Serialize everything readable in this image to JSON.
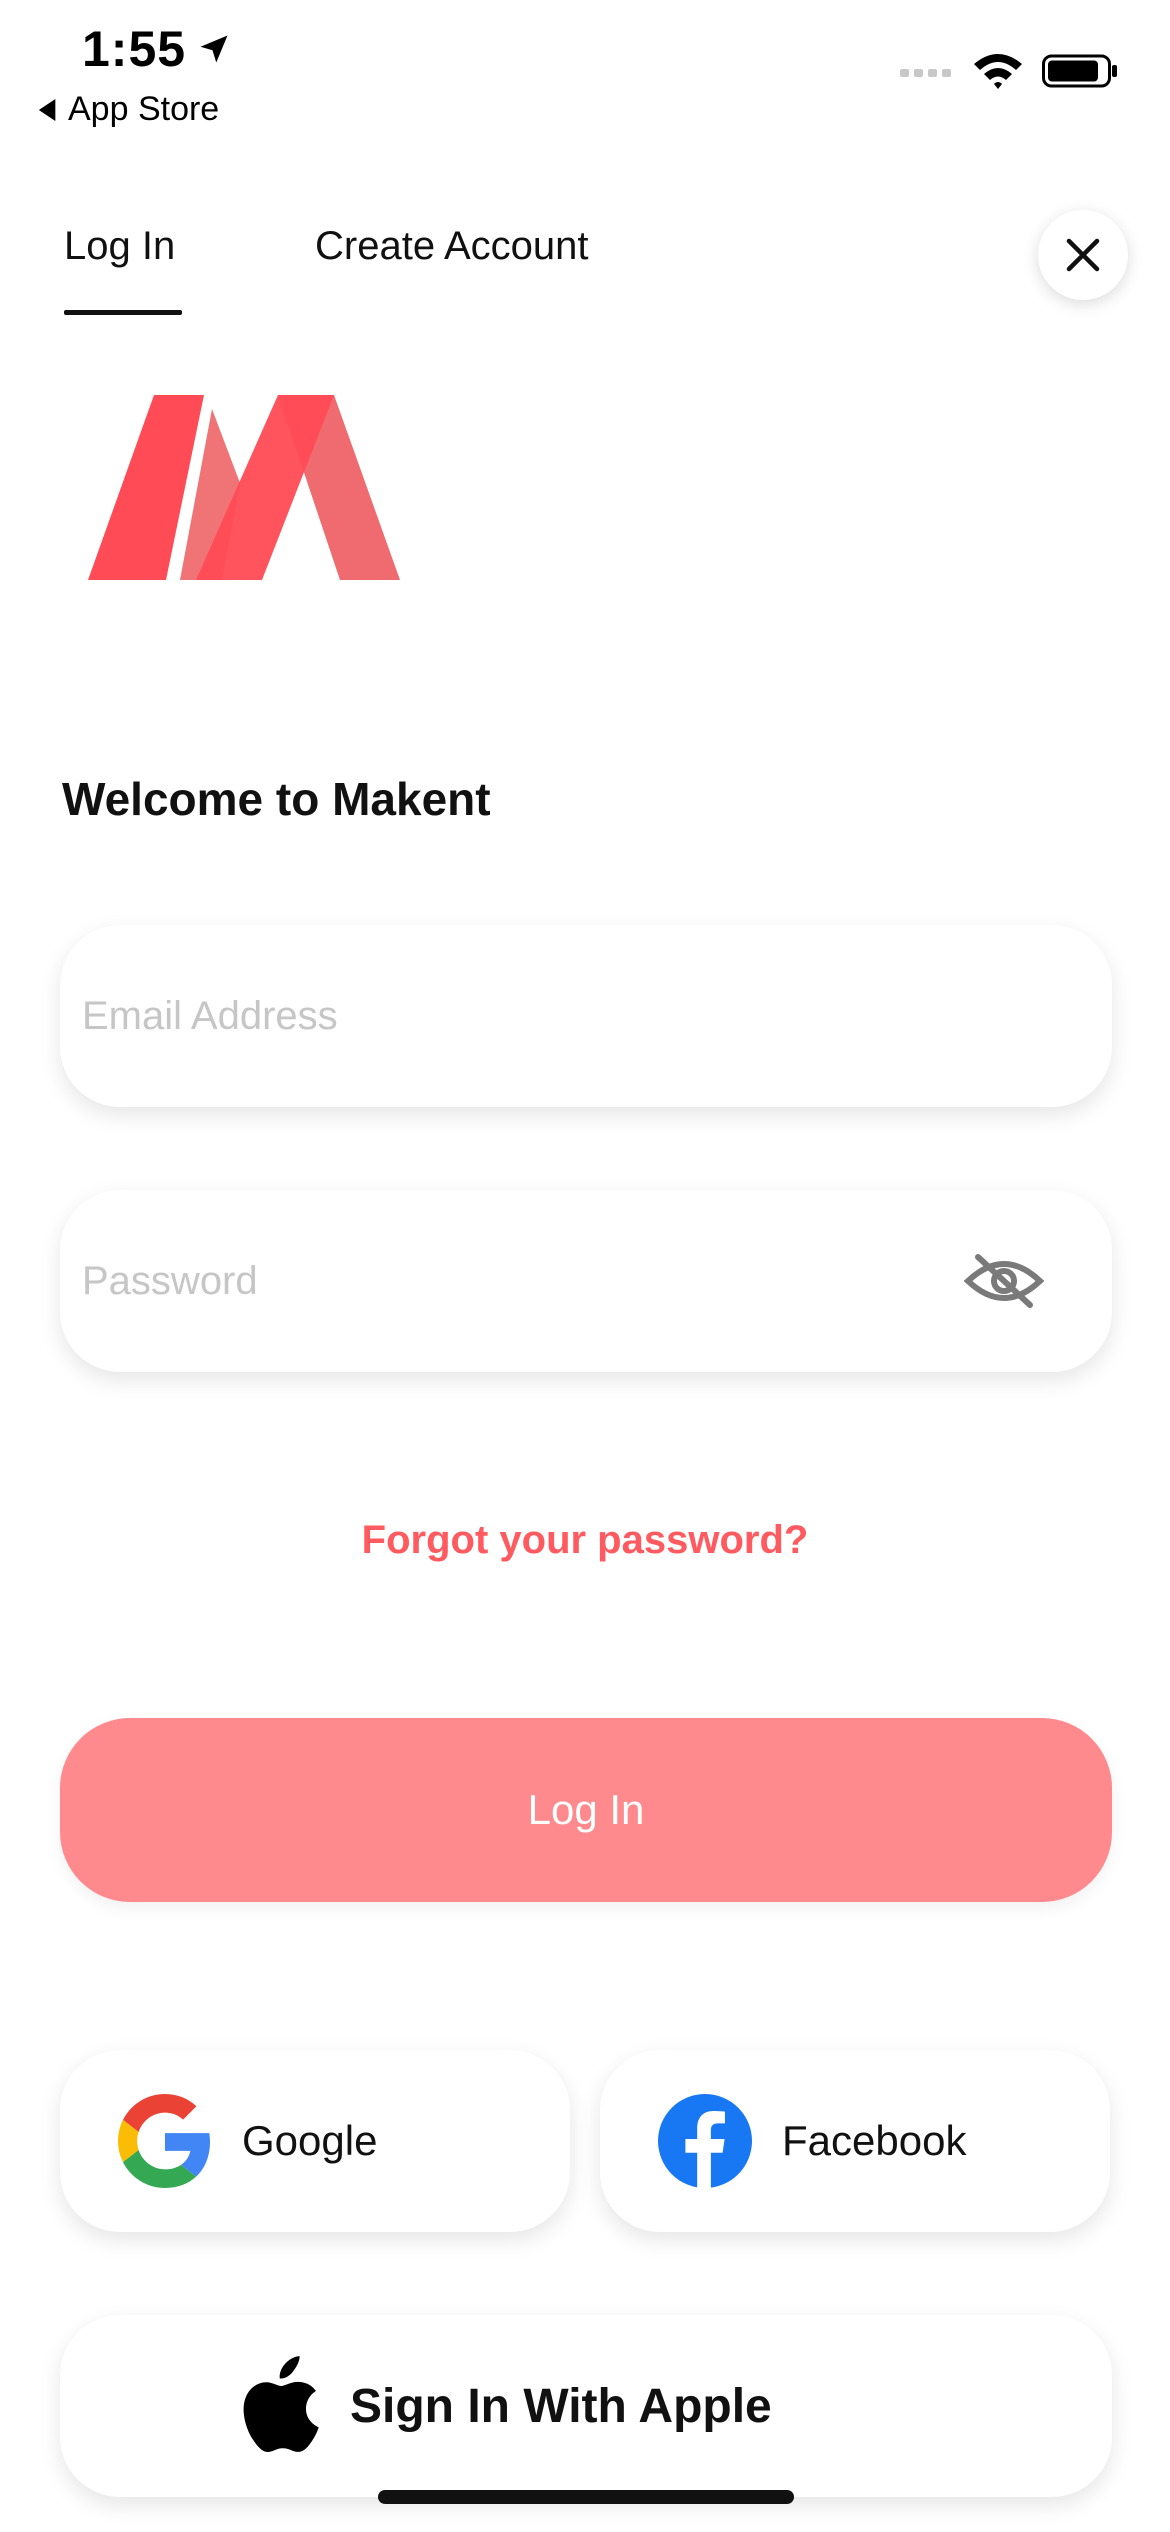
{
  "status_bar": {
    "time": "1:55",
    "back_label": "App Store"
  },
  "tabs": [
    {
      "label": "Log In",
      "active": true
    },
    {
      "label": "Create Account",
      "active": false
    }
  ],
  "brand": {
    "logo_name": "makent-logo",
    "colors": {
      "primary": "#ff4b55",
      "secondary": "#ef6b6f"
    }
  },
  "welcome_text": "Welcome to Makent",
  "form": {
    "email": {
      "placeholder": "Email Address",
      "value": ""
    },
    "password": {
      "placeholder": "Password",
      "value": ""
    }
  },
  "forgot_password": "Forgot your password?",
  "login_button": "Log In",
  "social": {
    "google": "Google",
    "facebook": "Facebook",
    "apple": "Sign In With Apple"
  },
  "accent_color": "#ff5a5f"
}
